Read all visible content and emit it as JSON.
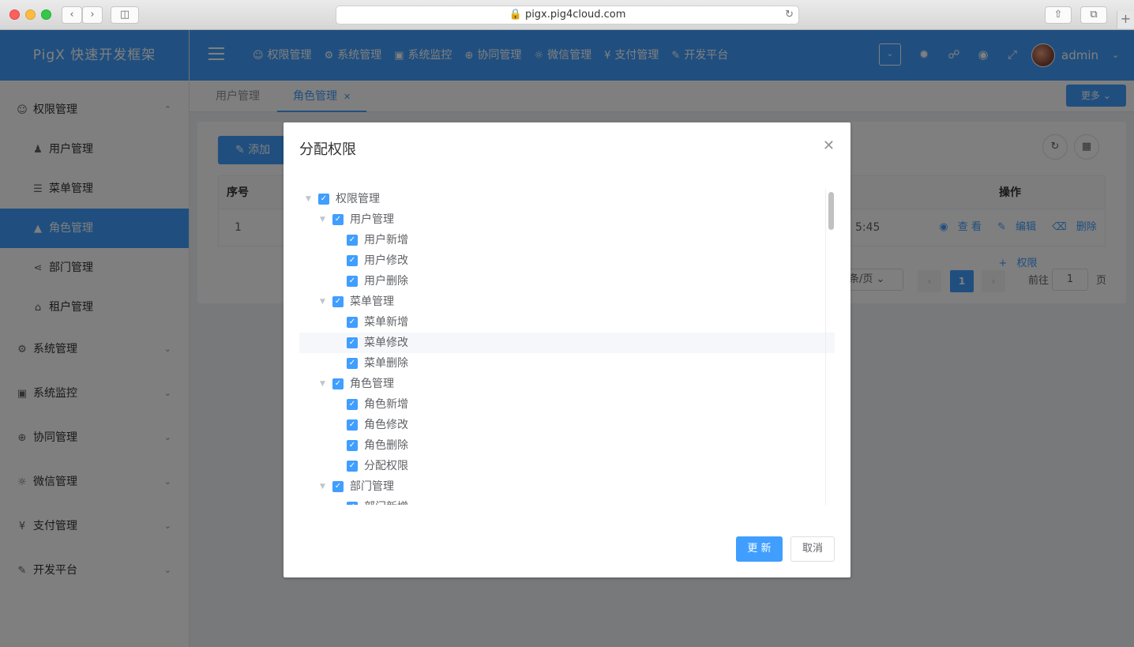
{
  "browser": {
    "url": "pigx.pig4cloud.com"
  },
  "app": {
    "logo_text": "PigX 快速开发框架"
  },
  "sidebar": {
    "groups": [
      {
        "label": "权限管理",
        "icon": "user-icon",
        "expanded": true,
        "items": [
          {
            "label": "用户管理",
            "icon": "users-icon"
          },
          {
            "label": "菜单管理",
            "icon": "list-icon"
          },
          {
            "label": "角色管理",
            "icon": "graduation-cap-icon",
            "active": true
          },
          {
            "label": "部门管理",
            "icon": "org-chart-icon"
          },
          {
            "label": "租户管理",
            "icon": "house-icon"
          }
        ]
      },
      {
        "label": "系统管理",
        "icon": "gear-icon"
      },
      {
        "label": "系统监控",
        "icon": "monitor-icon"
      },
      {
        "label": "协同管理",
        "icon": "plus-circle-icon"
      },
      {
        "label": "微信管理",
        "icon": "wechat-icon"
      },
      {
        "label": "支付管理",
        "icon": "yen-icon"
      },
      {
        "label": "开发平台",
        "icon": "edit-square-icon"
      }
    ]
  },
  "topnav": {
    "items": [
      {
        "label": "权限管理",
        "icon": "user-icon"
      },
      {
        "label": "系统管理",
        "icon": "gear-icon"
      },
      {
        "label": "系统监控",
        "icon": "monitor-icon"
      },
      {
        "label": "协同管理",
        "icon": "plus-circle-icon"
      },
      {
        "label": "微信管理",
        "icon": "wechat-icon"
      },
      {
        "label": "支付管理",
        "icon": "yen-icon"
      },
      {
        "label": "开发平台",
        "icon": "edit-square-icon"
      }
    ],
    "username": "admin"
  },
  "tabs": {
    "items": [
      {
        "label": "用户管理",
        "active": false
      },
      {
        "label": "角色管理",
        "active": true,
        "closable": true
      }
    ],
    "more_label": "更多"
  },
  "toolbar": {
    "add_label": "添加"
  },
  "table": {
    "headers": {
      "index": "序号",
      "actions": "操作"
    },
    "rows": [
      {
        "index": "1",
        "time_fragment": "5:45"
      }
    ],
    "actions": {
      "view": "查 看",
      "edit": "编辑",
      "delete": "删除",
      "permission": "权限"
    }
  },
  "pagination": {
    "page_size_label": "条/页",
    "current_page": "1",
    "goto_label": "前往",
    "goto_value": "1",
    "page_suffix": "页"
  },
  "dialog": {
    "title": "分配权限",
    "tree": [
      {
        "label": "权限管理",
        "level": 0,
        "expandable": true,
        "checked": true
      },
      {
        "label": "用户管理",
        "level": 1,
        "expandable": true,
        "checked": true
      },
      {
        "label": "用户新增",
        "level": 2,
        "checked": true
      },
      {
        "label": "用户修改",
        "level": 2,
        "checked": true
      },
      {
        "label": "用户删除",
        "level": 2,
        "checked": true
      },
      {
        "label": "菜单管理",
        "level": 1,
        "expandable": true,
        "checked": true
      },
      {
        "label": "菜单新增",
        "level": 2,
        "checked": true
      },
      {
        "label": "菜单修改",
        "level": 2,
        "checked": true,
        "highlighted": true
      },
      {
        "label": "菜单删除",
        "level": 2,
        "checked": true
      },
      {
        "label": "角色管理",
        "level": 1,
        "expandable": true,
        "checked": true
      },
      {
        "label": "角色新增",
        "level": 2,
        "checked": true
      },
      {
        "label": "角色修改",
        "level": 2,
        "checked": true
      },
      {
        "label": "角色删除",
        "level": 2,
        "checked": true
      },
      {
        "label": "分配权限",
        "level": 2,
        "checked": true
      },
      {
        "label": "部门管理",
        "level": 1,
        "expandable": true,
        "checked": true
      },
      {
        "label": "部门新增",
        "level": 2,
        "checked": true
      }
    ],
    "update_label": "更 新",
    "cancel_label": "取消"
  },
  "colors": {
    "primary": "#409eff",
    "overlay": "rgba(0,0,0,0.5)"
  }
}
